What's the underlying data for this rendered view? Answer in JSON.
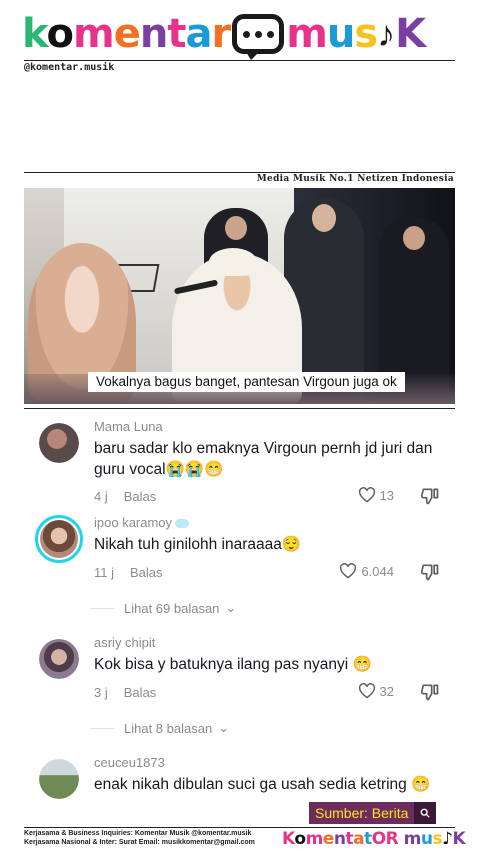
{
  "header": {
    "logo_letters": [
      {
        "ch": "k",
        "color": "#2bb673"
      },
      {
        "ch": "o",
        "color": "#111111"
      },
      {
        "ch": "m",
        "color": "#e8338a"
      },
      {
        "ch": "e",
        "color": "#f36f21"
      },
      {
        "ch": "n",
        "color": "#7b3fa0"
      },
      {
        "ch": "t",
        "color": "#e8338a"
      },
      {
        "ch": "a",
        "color": "#1b9ad6"
      },
      {
        "ch": "r",
        "color": "#f36f21"
      }
    ],
    "logo_letters_2": [
      {
        "ch": "m",
        "color": "#e8338a"
      },
      {
        "ch": "u",
        "color": "#1b9ad6"
      },
      {
        "ch": "s",
        "color": "#f7c21b"
      }
    ],
    "logo_letters_3": [
      {
        "ch": "K",
        "color": "#7b3fa0"
      }
    ],
    "note_icon": "music-note-icon",
    "handle": "@komentar.musik",
    "tagline": "Media Musik No.1 Netizen Indonesia"
  },
  "video": {
    "caption": "Vokalnya bagus banget, pantesan Virgoun juga ok"
  },
  "comments": [
    {
      "user": "Mama Luna",
      "text": "baru sadar klo emaknya Virgoun pernh jd juri dan guru vocal😭😭😁",
      "time": "4 j",
      "reply": "Balas",
      "likes": "13",
      "avatar_color": "#5b4a4a"
    },
    {
      "user": "ipoo karamoy",
      "text": "Nikah tuh ginilohh inaraaaa😌",
      "time": "11 j",
      "reply": "Balas",
      "likes": "6.044",
      "avatar_color": "#b08a7a",
      "view_replies": "Lihat 69 balasan"
    },
    {
      "user": "asriy chipit",
      "text": "Kok bisa y batuknya ilang pas nyanyi 😁",
      "time": "3 j",
      "reply": "Balas",
      "likes": "32",
      "avatar_color": "#6a5560",
      "view_replies": "Lihat 8 balasan"
    },
    {
      "user": "ceuceu1873",
      "text": "enak nikah dibulan suci ga usah sedia ketring 😁",
      "avatar_color": "#5f7a4a"
    }
  ],
  "source": {
    "label": "Sumber: Berita",
    "icon": "search-icon"
  },
  "footer": {
    "line1": "Kerjasama & Business Inquiries: Komentar Musik @komentar.musik",
    "line2": "Kerjasama Nasional & Inter: Surat Email: musikkomentar@gmail.com",
    "logo_letters": [
      {
        "ch": "K",
        "color": "#e8338a"
      },
      {
        "ch": "o",
        "color": "#111111"
      },
      {
        "ch": "m",
        "color": "#e8338a"
      },
      {
        "ch": "e",
        "color": "#f36f21"
      },
      {
        "ch": "n",
        "color": "#7b3fa0"
      },
      {
        "ch": "t",
        "color": "#e8338a"
      },
      {
        "ch": "a",
        "color": "#f36f21"
      },
      {
        "ch": "t",
        "color": "#1b9ad6"
      },
      {
        "ch": "O",
        "color": "#e8338a"
      },
      {
        "ch": "R",
        "color": "#e8338a"
      },
      {
        "ch": " ",
        "color": "#111111"
      },
      {
        "ch": "m",
        "color": "#7b3fa0"
      },
      {
        "ch": "u",
        "color": "#1b9ad6"
      },
      {
        "ch": "s",
        "color": "#f7c21b"
      },
      {
        "ch": "♪",
        "color": "#111111"
      },
      {
        "ch": "K",
        "color": "#7b3fa0"
      }
    ]
  }
}
